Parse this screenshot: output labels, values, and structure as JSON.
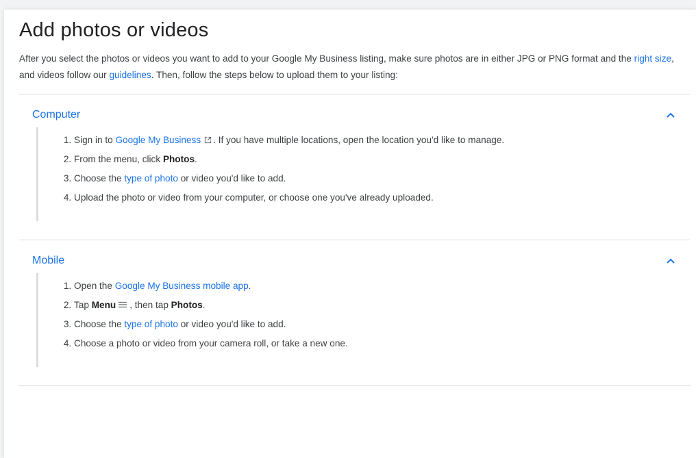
{
  "article": {
    "title": "Add photos or videos",
    "intro": {
      "part1": "After you select the photos or videos you want to add to your Google My Business listing, make sure photos are in either JPG or PNG format and the ",
      "link1": "right size",
      "part2": ", and videos follow our ",
      "link2": "guidelines",
      "part3": ". Then, follow the steps below to upload them to your listing:"
    }
  },
  "sections": {
    "computer": {
      "title": "Computer",
      "toggle_icon": "chevron-up-icon",
      "steps": {
        "s1_pre": "Sign in to ",
        "s1_link": "Google My Business",
        "s1_post": ". If you have multiple locations, open the location you'd like to manage.",
        "s2_pre": "From the menu, click ",
        "s2_bold": "Photos",
        "s2_post": ".",
        "s3_pre": "Choose the ",
        "s3_link": "type of photo",
        "s3_post": " or video you'd like to add.",
        "s4": "Upload the photo or video from your computer, or choose one you've already uploaded."
      }
    },
    "mobile": {
      "title": "Mobile",
      "toggle_icon": "chevron-up-icon",
      "steps": {
        "s1_pre": "Open the ",
        "s1_link": "Google My Business mobile app",
        "s1_post": ".",
        "s2_pre": "Tap ",
        "s2_bold1": "Menu",
        "s2_mid": ", then tap ",
        "s2_bold2": "Photos",
        "s2_post": ".",
        "s3_pre": "Choose the ",
        "s3_link": "type of photo",
        "s3_post": " or video you'd like to add.",
        "s4": "Choose a photo or video from your camera roll, or take a new one."
      }
    }
  },
  "colors": {
    "link": "#1a73e8",
    "text": "#3c4043",
    "divider": "#dadce0"
  }
}
